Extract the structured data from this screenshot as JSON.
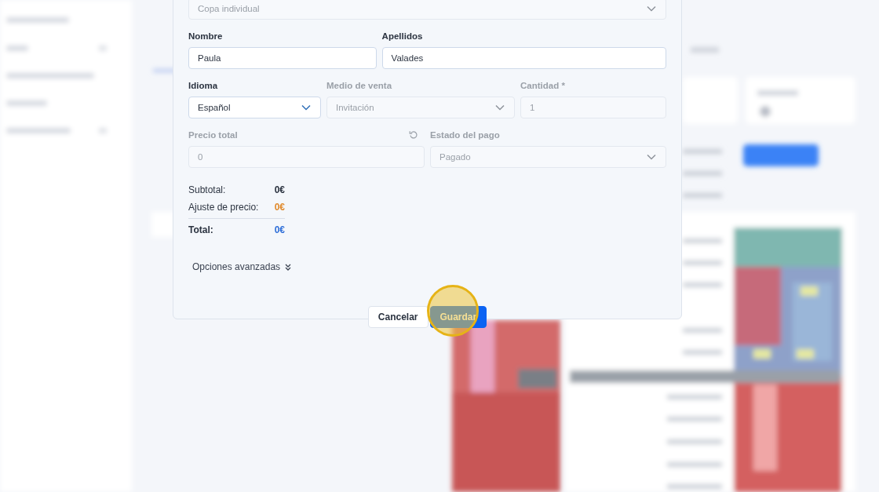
{
  "modal": {
    "top_select": {
      "value": "Copa individual",
      "disabled": true
    },
    "rows": [
      [
        {
          "label": "Nombre",
          "kind": "input",
          "value": "Paula",
          "disabled": false
        },
        {
          "label": "Apellidos",
          "kind": "input",
          "value": "Valades",
          "disabled": false
        }
      ],
      [
        {
          "label": "Idioma",
          "kind": "select",
          "value": "Español",
          "disabled": false
        },
        {
          "label": "Medio de venta",
          "kind": "select",
          "value": "Invitación",
          "disabled": true
        },
        {
          "label": "Cantidad *",
          "kind": "input",
          "value": "1",
          "disabled": true
        }
      ],
      [
        {
          "label": "Precio total",
          "kind": "resettable",
          "value": "0",
          "disabled": true
        },
        {
          "label": "Estado del pago",
          "kind": "select",
          "value": "Pagado",
          "disabled": true
        }
      ]
    ],
    "totals": [
      {
        "label": "Subtotal:",
        "value": "0€",
        "kind": "normal"
      },
      {
        "label": "Ajuste de precio:",
        "value": "0€",
        "kind": "adjust"
      },
      {
        "label": "Total:",
        "value": "0€",
        "kind": "total"
      }
    ],
    "advanced": {
      "label": "Opciones avanzadas",
      "expanded": false
    },
    "buttons": [
      {
        "label": "Cancelar",
        "kind": "secondary"
      },
      {
        "label": "Guardar",
        "kind": "primary"
      }
    ],
    "click_highlight": true
  }
}
